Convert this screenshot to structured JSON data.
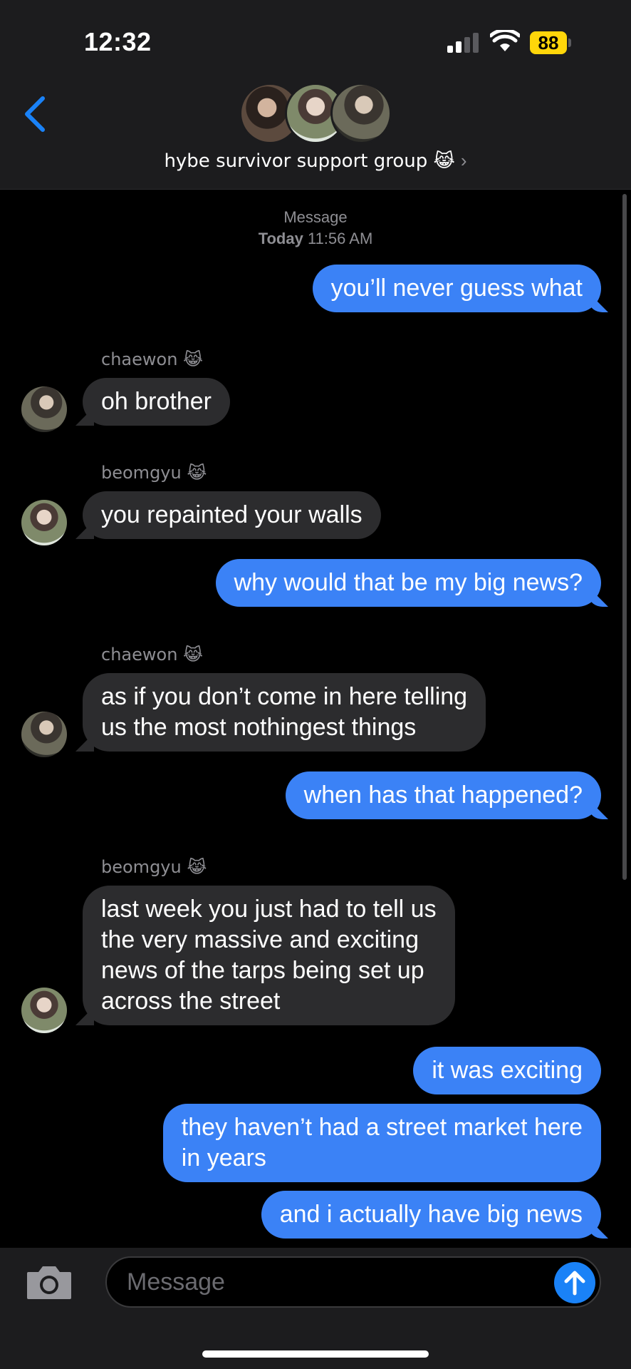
{
  "status_bar": {
    "time": "12:32",
    "battery": "88"
  },
  "header": {
    "group_name": "hybe survivor support group 😹",
    "chevron": "›"
  },
  "thread": {
    "timestamp_label": "Message",
    "timestamp_day": "Today",
    "timestamp_time": "11:56 AM",
    "sender_chaewon": "chaewon 😹",
    "sender_beomgyu": "beomgyu 😹",
    "messages": [
      {
        "from": "me",
        "text": "you’ll never guess what"
      },
      {
        "from": "chaewon",
        "text": "oh brother"
      },
      {
        "from": "beomgyu",
        "text": "you repainted your walls"
      },
      {
        "from": "me",
        "text": "why would that be my big news?"
      },
      {
        "from": "chaewon",
        "lines": [
          "as if you don’t come in here telling",
          "us the most nothingest things"
        ]
      },
      {
        "from": "me",
        "text": "when has that happened?"
      },
      {
        "from": "beomgyu",
        "lines": [
          "last week you just had to tell us",
          "the very massive and exciting",
          "news of the tarps being set up",
          "across the street"
        ]
      },
      {
        "from": "me",
        "text": "it was exciting"
      },
      {
        "from": "me",
        "lines": [
          "they haven’t had a street market here",
          "in years"
        ]
      },
      {
        "from": "me",
        "text": "and i actually have big news"
      }
    ]
  },
  "composer": {
    "placeholder": "Message"
  },
  "icons": {
    "back": "chevron-left-icon",
    "camera": "camera-icon",
    "send": "arrow-up-icon",
    "signal": "cellular-signal-icon",
    "wifi": "wifi-icon",
    "battery": "battery-icon"
  },
  "colors": {
    "outgoing_bubble": "#3b82f6",
    "incoming_bubble": "#2c2c2e",
    "accent": "#1a82f7",
    "battery": "#ffd60a"
  }
}
